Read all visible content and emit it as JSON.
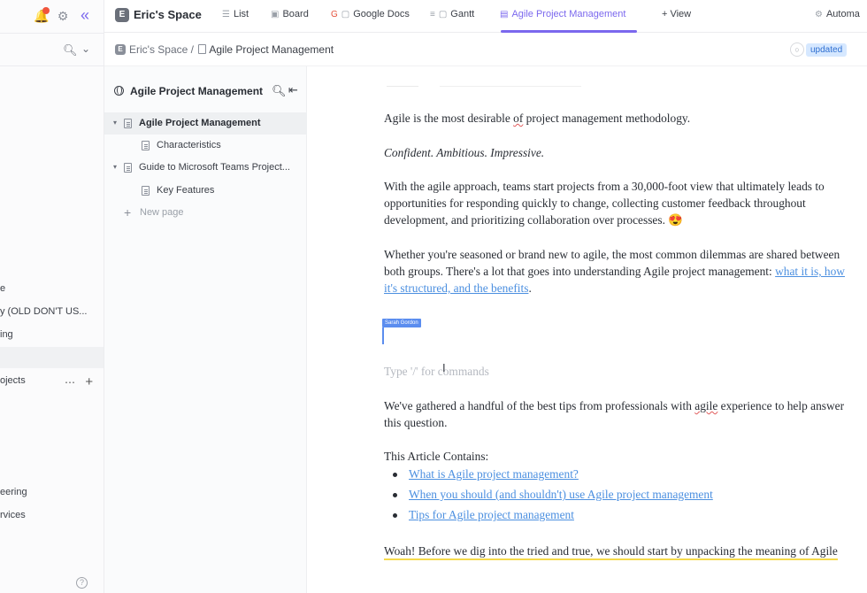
{
  "sidebar": {
    "notification_badge_color": "#f0553c",
    "items": [
      {
        "label": "e"
      },
      {
        "label": "y (OLD DON'T US..."
      },
      {
        "label": "ing"
      },
      {
        "label": "ojects"
      },
      {
        "label": "eering"
      },
      {
        "label": "rvices"
      }
    ],
    "help_label": "?"
  },
  "topbar": {
    "space_initial": "E",
    "space_title": "Eric's Space",
    "tabs": [
      {
        "label": "List",
        "icon": "list-icon"
      },
      {
        "label": "Board",
        "icon": "board-icon"
      },
      {
        "label": "Google Docs",
        "icon": "google-docs-icon"
      },
      {
        "label": "Gantt",
        "icon": "gantt-icon"
      },
      {
        "label": "Agile Project Management",
        "icon": "doc-icon",
        "active": true
      },
      {
        "label": "+ View",
        "icon": "add-view"
      }
    ],
    "automations_label": "Automa"
  },
  "breadcrumb": {
    "space_initial": "E",
    "space": "Eric's Space",
    "separator": "/",
    "current": "Agile Project Management",
    "status_badge": "updated"
  },
  "tree": {
    "title": "Agile Project Management",
    "items": [
      {
        "label": "Agile Project Management",
        "selected": true
      },
      {
        "label": "Characteristics"
      },
      {
        "label": "Guide to Microsoft Teams Project..."
      },
      {
        "label": "Key Features"
      }
    ],
    "new_page_label": "New page"
  },
  "document": {
    "p1_before": "Agile is the most desirable ",
    "p1_squiggle": "of",
    "p1_after": " project management methodology.",
    "p2": "Confident. Ambitious. Impressive.",
    "p3_line1": "With the agile approach, teams start projects from a 30,000-foot view that ultimately leads to",
    "p3_line2": "opportunities for responding quickly to change, collecting customer feedback throughout",
    "p3_line3": "development, and prioritizing collaboration over processes. 😍",
    "p4_line1_text": "Whether you're seasoned or brand new to agile, the most common dilemmas are shared between",
    "p4_line2_text": "both groups. There's a lot that goes into understanding Agile project management: ",
    "p4_line2_link": "what it is, how",
    "p4_line3_link": "it's structured, and the benefits",
    "p4_line3_end": ".",
    "collab_cursor_name": "Sarah Gordon",
    "collab_cursor_color": "#5b8def",
    "placeholder": "Type '/' for commands",
    "p5_line1_before": "We've gathered a handful of the best tips from professionals with ",
    "p5_line1_squiggle": "agile",
    "p5_line1_after": " experience to help answer",
    "p5_line2": "this question.",
    "contains_heading": "This Article Contains:",
    "bullets": [
      "What is Agile project management? ",
      "When you should (and shouldn't) use Agile project management",
      "Tips for Agile project management"
    ],
    "p6": "Woah! Before we dig into the tried and true, we should start by unpacking the meaning of Agile",
    "link_color": "#4b8fe0",
    "highlight_color": "#f5d94a"
  },
  "accent_color": "#7b68ee"
}
